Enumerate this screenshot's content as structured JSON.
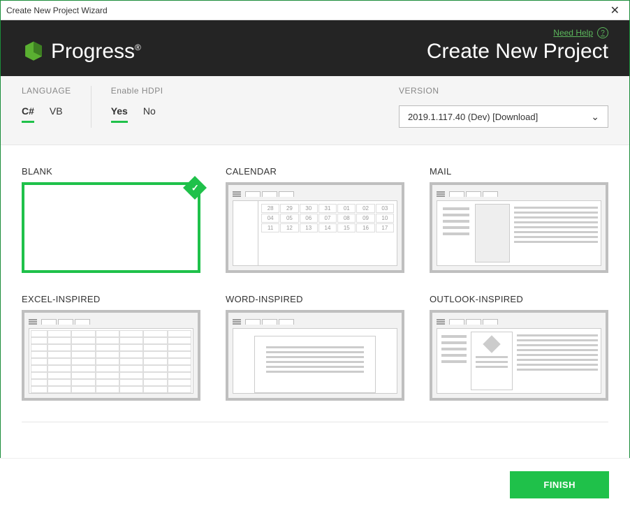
{
  "window": {
    "title": "Create New Project Wizard"
  },
  "header": {
    "help_link": "Need Help",
    "brand": "Progress",
    "page_title": "Create New Project"
  },
  "options": {
    "language": {
      "label": "LANGUAGE",
      "items": [
        "C#",
        "VB"
      ],
      "selected": "C#"
    },
    "hdpi": {
      "label": "Enable HDPI",
      "items": [
        "Yes",
        "No"
      ],
      "selected": "Yes"
    },
    "version": {
      "label": "VERSION",
      "value": "2019.1.117.40 (Dev) [Download]"
    }
  },
  "templates": [
    {
      "id": "blank",
      "label": "BLANK",
      "selected": true
    },
    {
      "id": "calendar",
      "label": "CALENDAR",
      "selected": false,
      "days": [
        "28",
        "29",
        "30",
        "31",
        "01",
        "02",
        "03",
        "04",
        "05",
        "06",
        "07",
        "08",
        "09",
        "10",
        "11",
        "12",
        "13",
        "14",
        "15",
        "16",
        "17"
      ]
    },
    {
      "id": "mail",
      "label": "MAIL",
      "selected": false
    },
    {
      "id": "excel",
      "label": "EXCEL-INSPIRED",
      "selected": false
    },
    {
      "id": "word",
      "label": "WORD-INSPIRED",
      "selected": false
    },
    {
      "id": "outlook",
      "label": "OUTLOOK-INSPIRED",
      "selected": false
    }
  ],
  "footer": {
    "finish": "FINISH"
  }
}
